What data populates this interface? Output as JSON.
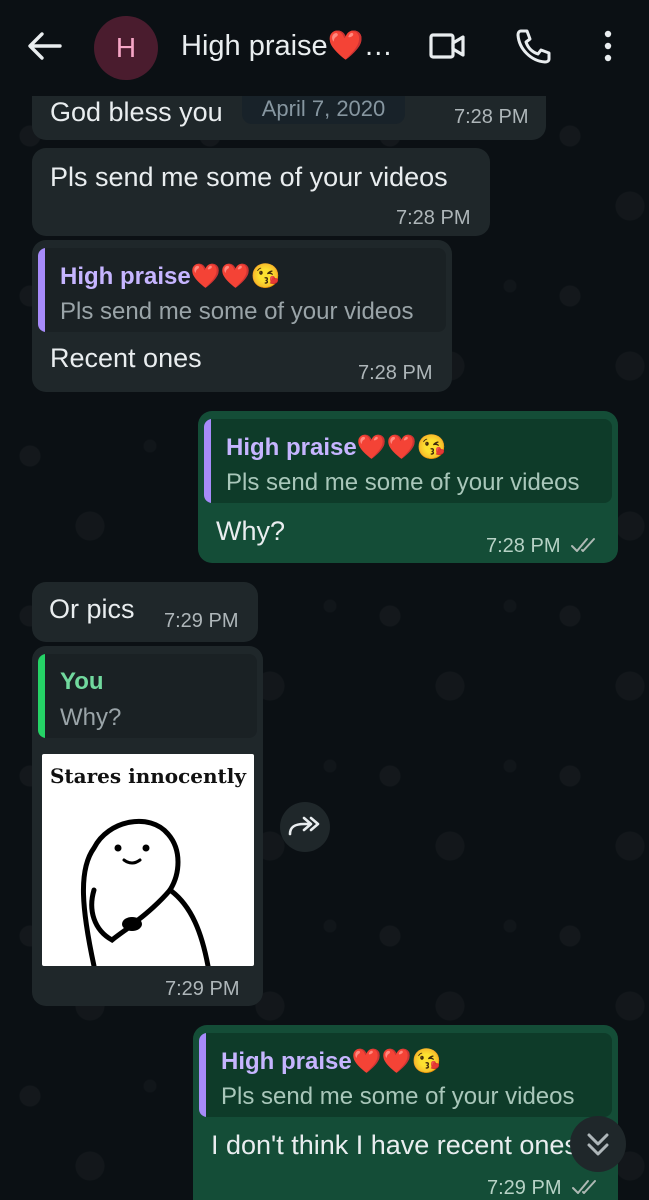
{
  "header": {
    "avatar_letter": "H",
    "title": "High praise❤️…"
  },
  "date_chip": "April 7, 2020",
  "messages": [
    {
      "text": "God bless you",
      "time": "7:28 PM"
    },
    {
      "text": "Pls send me some of your videos",
      "time": "7:28 PM"
    },
    {
      "quote_author": "High praise❤️❤️😘",
      "quote_text": "Pls send me some of your videos",
      "text": "Recent ones",
      "time": "7:28 PM"
    },
    {
      "quote_author": "High praise❤️❤️😘",
      "quote_text": "Pls send me some of your videos",
      "text": "Why?",
      "time": "7:28 PM"
    },
    {
      "text": "Or pics",
      "time": "7:29 PM"
    },
    {
      "quote_author": "You",
      "quote_text": "Why?",
      "sticker_caption": "Stares innocently",
      "time": "7:29 PM"
    },
    {
      "quote_author": "High praise❤️❤️😘",
      "quote_text": "Pls send me some of your videos",
      "text": "I don't think I have recent ones",
      "time": "7:29 PM"
    }
  ],
  "colors": {
    "incoming_bubble": "#1f272a",
    "outgoing_bubble": "#144d37",
    "quote_bar_contact": "#a78bfa",
    "quote_bar_you": "#25d366",
    "quote_author_contact": "#c6b5ff",
    "quote_author_you": "#71d99e"
  },
  "icons": {
    "back": "arrow-left-icon",
    "video": "video-camera-icon",
    "call": "phone-icon",
    "menu": "more-vertical-icon",
    "forward": "forward-double-arrow-icon",
    "scroll_down": "double-chevron-down-icon",
    "read_receipt": "double-check-icon"
  }
}
